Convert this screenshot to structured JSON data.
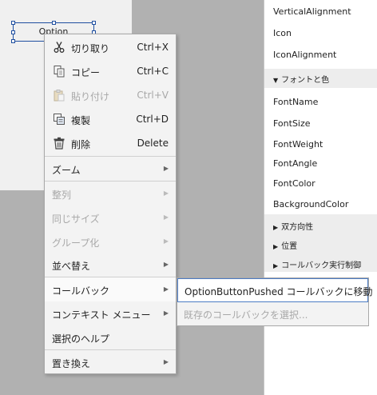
{
  "component": {
    "label": "Option"
  },
  "properties": {
    "items_top": [
      "VerticalAlignment",
      "Icon",
      "IconAlignment"
    ],
    "font_group": "フォントと色",
    "font_items": [
      "FontName",
      "FontSize",
      "FontWeight",
      "FontAngle",
      "FontColor",
      "BackgroundColor"
    ],
    "groups": [
      "双方向性",
      "位置",
      "コールバック実行制御"
    ]
  },
  "context_menu": {
    "items": [
      {
        "label": "切り取り",
        "shortcut": "Ctrl+X",
        "icon": "scissors-icon"
      },
      {
        "label": "コピー",
        "shortcut": "Ctrl+C",
        "icon": "copy-icon"
      },
      {
        "label": "貼り付け",
        "shortcut": "Ctrl+V",
        "icon": "paste-icon",
        "disabled": true
      },
      {
        "label": "複製",
        "shortcut": "Ctrl+D",
        "icon": "duplicate-icon"
      },
      {
        "label": "削除",
        "shortcut": "Delete",
        "icon": "trash-icon"
      },
      {
        "label": "ズーム",
        "submenu": true
      },
      {
        "label": "整列",
        "submenu": true,
        "disabled": true
      },
      {
        "label": "同じサイズ",
        "submenu": true,
        "disabled": true
      },
      {
        "label": "グループ化",
        "submenu": true,
        "disabled": true
      },
      {
        "label": "並べ替え",
        "submenu": true
      },
      {
        "label": "コールバック",
        "submenu": true,
        "active": true
      },
      {
        "label": "コンテキスト メニュー",
        "submenu": true
      },
      {
        "label": "選択のヘルプ"
      },
      {
        "label": "置き換え",
        "submenu": true
      }
    ]
  },
  "callback_submenu": {
    "items": [
      {
        "label": "OptionButtonPushed コールバックに移動",
        "active": true
      },
      {
        "label": "既存のコールバックを選択...",
        "disabled": true
      }
    ]
  }
}
